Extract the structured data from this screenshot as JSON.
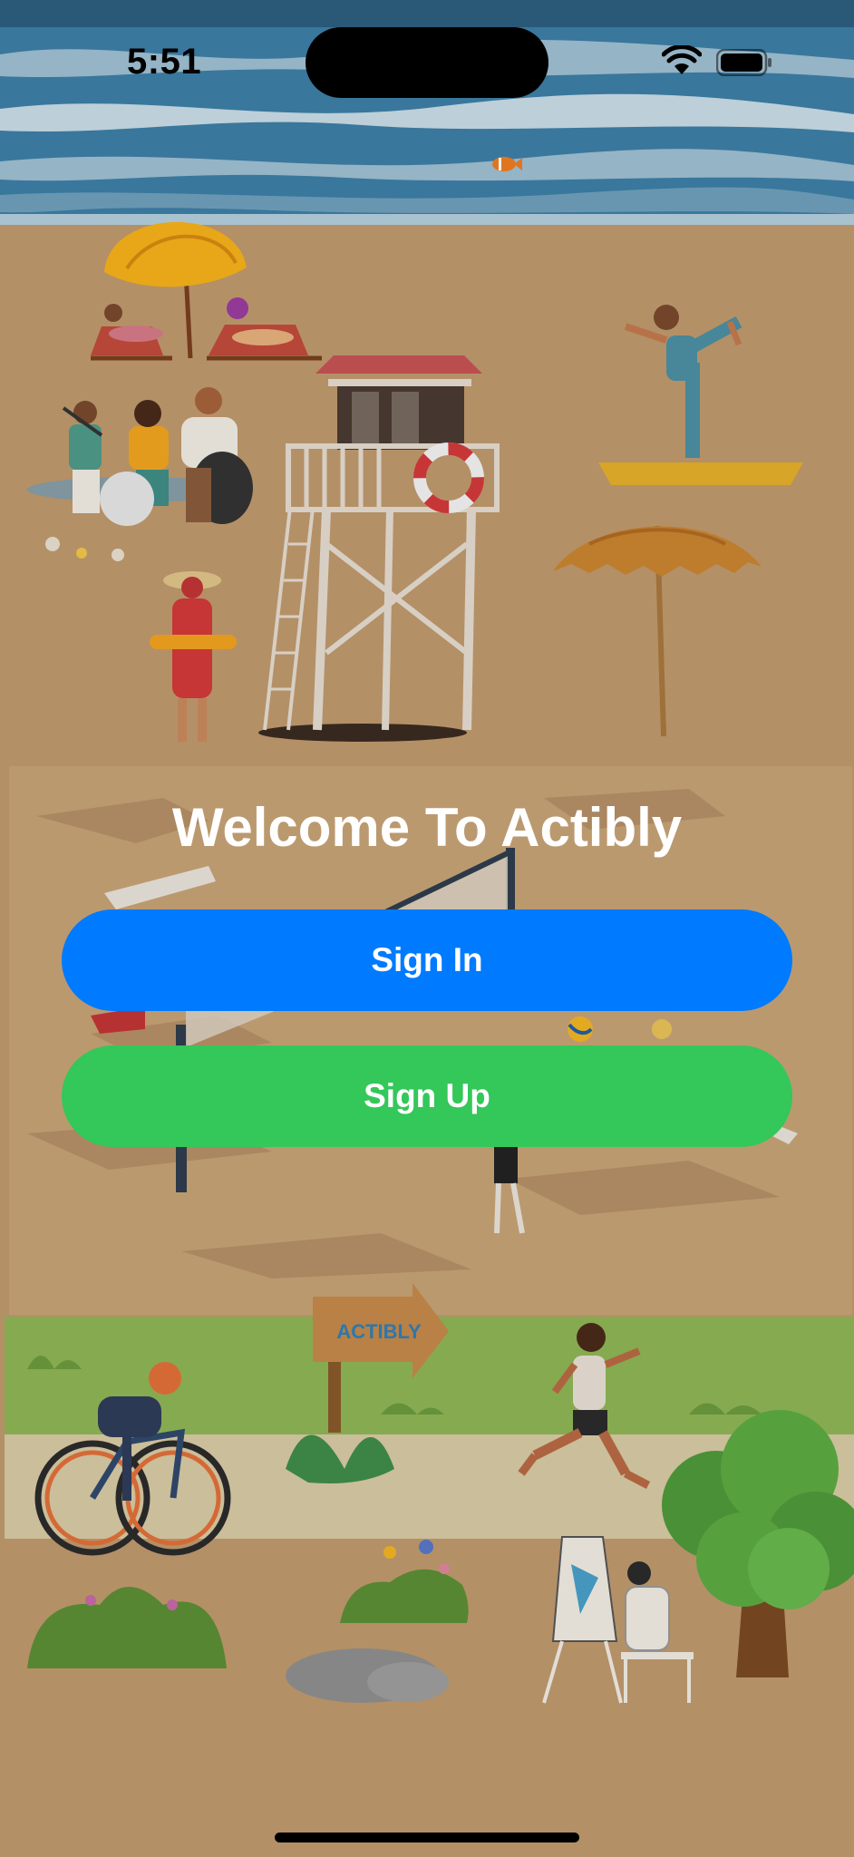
{
  "status_bar": {
    "time": "5:51"
  },
  "welcome": {
    "title": "Welcome To Actibly"
  },
  "buttons": {
    "sign_in": {
      "label": "Sign In",
      "color": "#007aff"
    },
    "sign_up": {
      "label": "Sign Up",
      "color": "#34c759"
    }
  },
  "signpost": {
    "text": "ACTIBLY"
  },
  "icons": [
    "wifi-icon",
    "battery-icon"
  ]
}
